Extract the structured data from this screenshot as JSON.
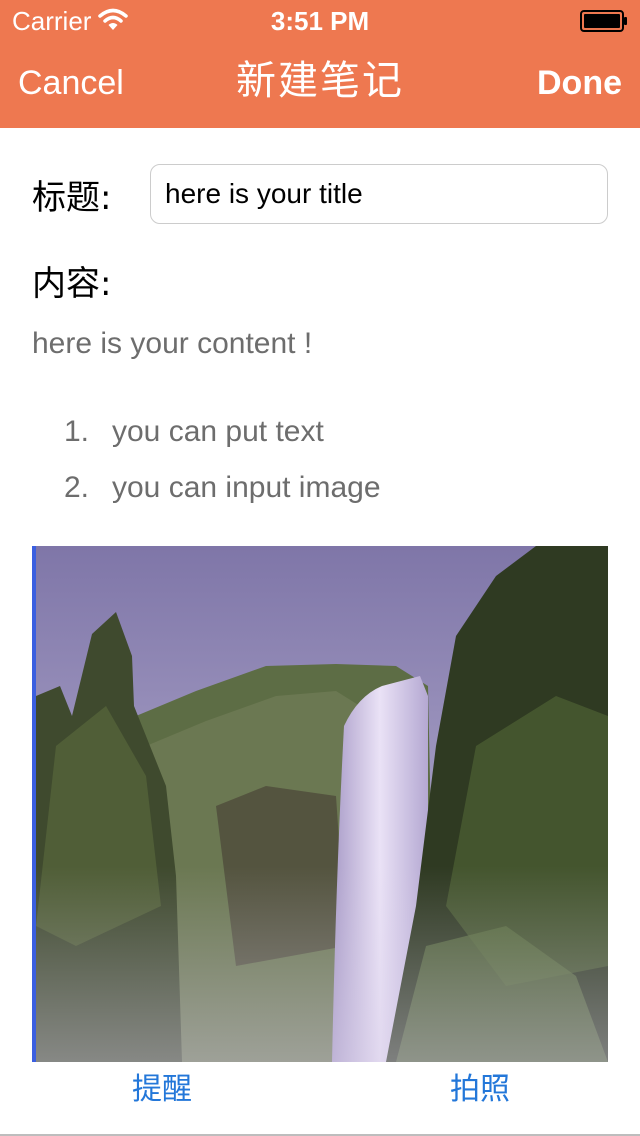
{
  "status_bar": {
    "carrier": "Carrier",
    "time": "3:51 PM",
    "wifi_icon": "wifi-icon",
    "battery_icon": "battery-icon"
  },
  "nav": {
    "cancel": "Cancel",
    "title": "新建笔记",
    "done": "Done",
    "background_color": "#EE7850"
  },
  "form": {
    "title_label": "标题:",
    "title_value": "here is your title",
    "content_label": "内容:",
    "content_text": "here is your content !",
    "list_items": [
      {
        "number": "1.",
        "text": "you can put text"
      },
      {
        "number": "2.",
        "text": "you can input image"
      }
    ]
  },
  "image": {
    "description_icon": "waterfall-photo"
  },
  "toolbar": {
    "reminder": "提醒",
    "camera": "拍照",
    "link_color": "#2377D9"
  }
}
